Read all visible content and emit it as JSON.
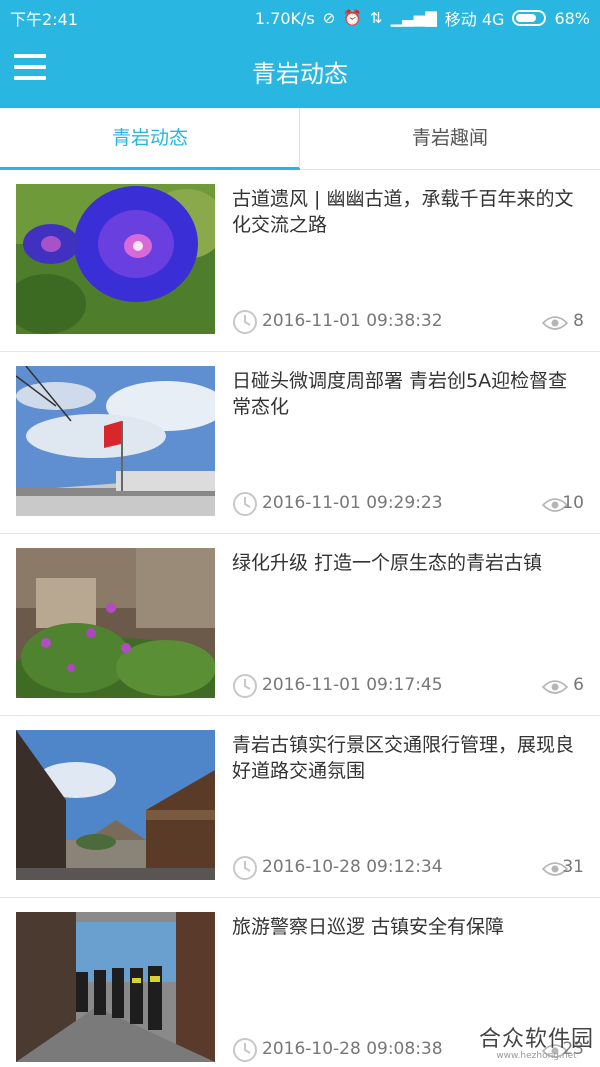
{
  "status_bar": {
    "time": "下午2:41",
    "net_speed": "1.70K/s",
    "carrier": "移动 4G",
    "battery": "68%"
  },
  "app_bar": {
    "title": "青岩动态",
    "menu_icon": "hamburger-menu-icon"
  },
  "tabs": [
    {
      "label": "青岩动态",
      "active": true
    },
    {
      "label": "青岩趣闻",
      "active": false
    }
  ],
  "news": [
    {
      "title": "古道遗风 | 幽幽古道，承载千百年来的文化交流之路",
      "time": "2016-11-01 09:38:32",
      "views": "8"
    },
    {
      "title": "日碰头微调度周部署 青岩创5A迎检督查常态化",
      "time": "2016-11-01 09:29:23",
      "views": "10"
    },
    {
      "title": "绿化升级 打造一个原生态的青岩古镇",
      "time": "2016-11-01 09:17:45",
      "views": "6"
    },
    {
      "title": "青岩古镇实行景区交通限行管理，展现良好道路交通氛围",
      "time": "2016-10-28 09:12:34",
      "views": "31"
    },
    {
      "title": "旅游警察日巡逻 古镇安全有保障",
      "time": "2016-10-28 09:08:38",
      "views": "23"
    }
  ],
  "watermark": {
    "main": "合众软件园",
    "sub": "www.hezhong.net"
  },
  "colors": {
    "accent": "#29b6e0",
    "divider": "#e6e6e6"
  }
}
